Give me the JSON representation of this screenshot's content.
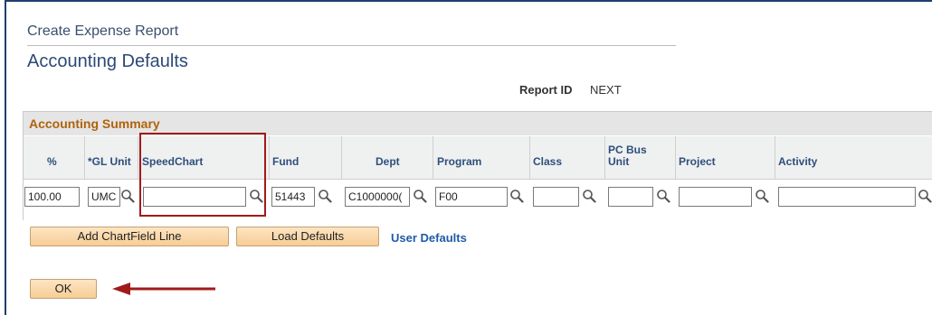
{
  "header": {
    "breadcrumb": "Create Expense Report",
    "page_title": "Accounting Defaults",
    "report_id_label": "Report ID",
    "report_id_value": "NEXT"
  },
  "grid": {
    "title": "Accounting Summary",
    "columns": {
      "pct": "%",
      "gl_unit": "*GL Unit",
      "speedchart": "SpeedChart",
      "fund": "Fund",
      "dept": "Dept",
      "program": "Program",
      "class": "Class",
      "pc_bus_unit_1": "PC Bus",
      "pc_bus_unit_2": "Unit",
      "project": "Project",
      "activity": "Activity"
    },
    "row": {
      "pct": "100.00",
      "gl_unit": "UMC",
      "speedchart": "",
      "fund": "51443",
      "dept": "C1000000(",
      "program": "F00",
      "class": "",
      "pc_bus_unit": "",
      "project": "",
      "activity": ""
    }
  },
  "actions": {
    "add_line": "Add ChartField Line",
    "load_defaults": "Load Defaults",
    "user_defaults": "User Defaults",
    "ok": "OK"
  },
  "icons": {
    "lookup": "magnifier-lookup-icon",
    "arrow": "red-arrow-left-icon"
  },
  "colors": {
    "accent_title": "#2b4a76",
    "grid_title": "#b1620b",
    "column_header": "#2d4f7c",
    "link": "#1e5ba8",
    "highlight": "#a11a1a",
    "button_fill": "#f7cd95"
  }
}
